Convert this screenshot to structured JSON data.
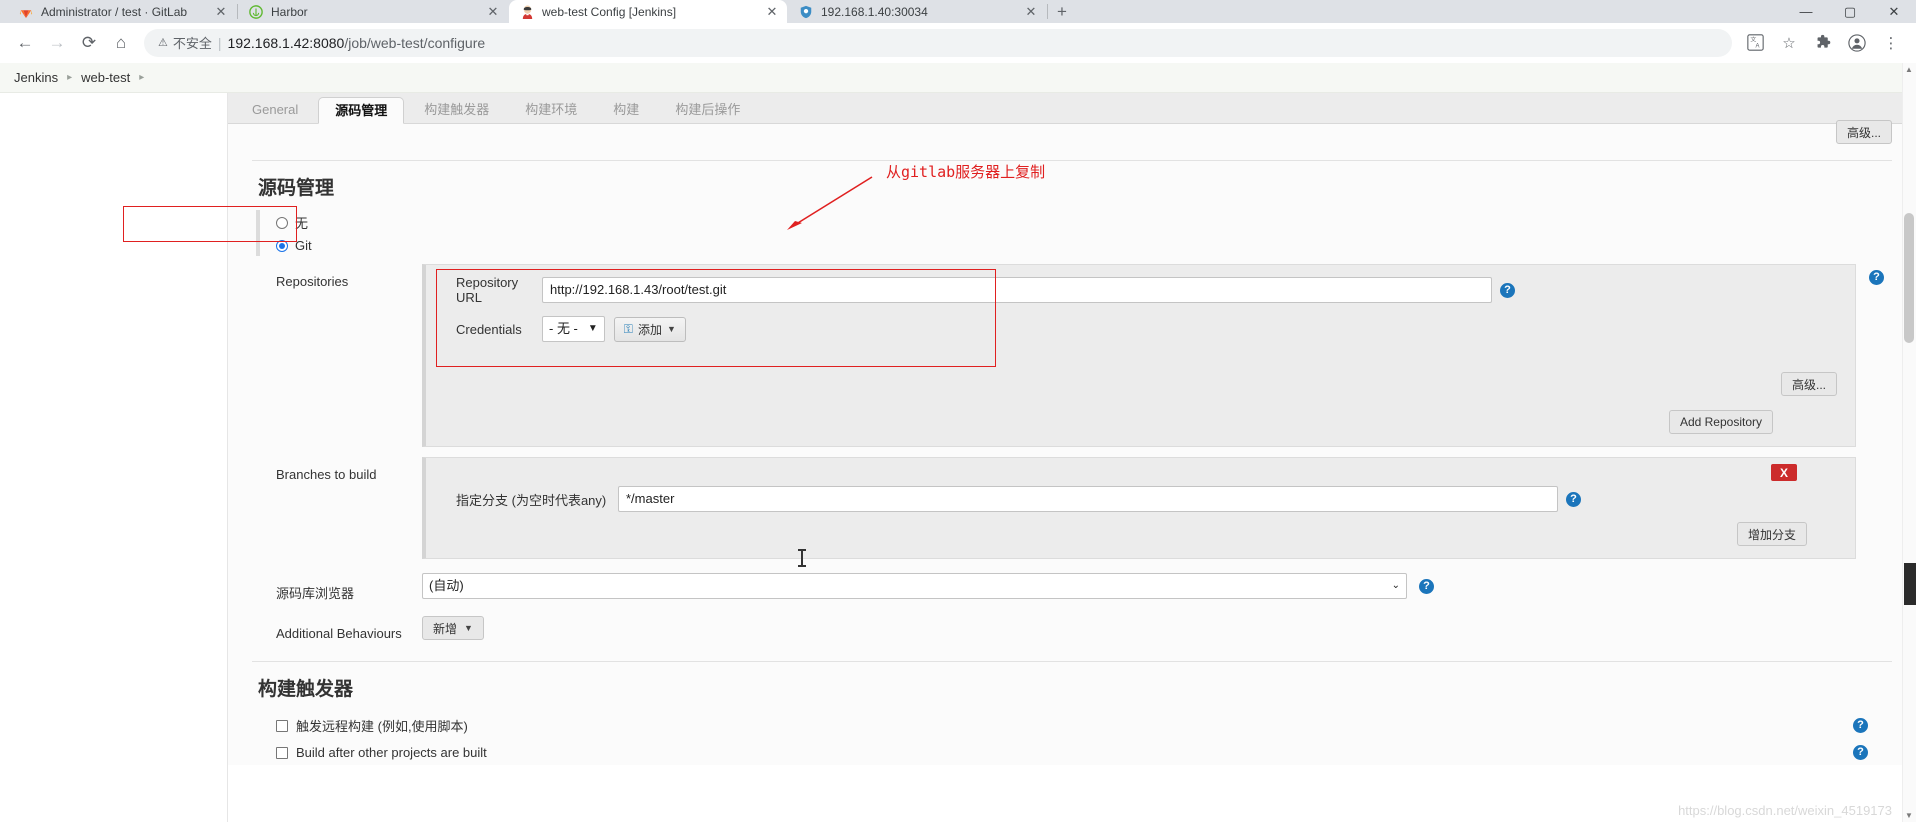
{
  "browser": {
    "tabs": [
      {
        "title": "Administrator / test · GitLab",
        "favicon": "gitlab-icon",
        "glyph": "🦊",
        "active": false
      },
      {
        "title": "Harbor",
        "favicon": "harbor-icon",
        "glyph": "🛡",
        "active": false
      },
      {
        "title": "web-test Config [Jenkins]",
        "favicon": "jenkins-icon",
        "glyph": "👤",
        "active": true
      },
      {
        "title": "192.168.1.40:30034",
        "favicon": "shield-icon",
        "glyph": "🛡",
        "active": false
      }
    ],
    "new_tab_label": "+",
    "window_controls": [
      "—",
      "▢",
      "✕"
    ],
    "nav": {
      "back": "←",
      "forward": "→",
      "reload": "⟳",
      "home": "⌂"
    },
    "omnibox": {
      "warning_icon": "not-secure-icon",
      "warning_text": "不安全",
      "url_host": "192.168.1.42:8080",
      "url_path": "/job/web-test/configure"
    },
    "toolbar_icons": [
      "translate-icon",
      "bookmark-star-icon",
      "extensions-icon",
      "profile-icon",
      "menu-icon"
    ]
  },
  "breadcrumbs": {
    "items": [
      "Jenkins",
      "web-test"
    ],
    "separator": "▸"
  },
  "config_tabs": [
    {
      "label": "General",
      "active": false
    },
    {
      "label": "源码管理",
      "active": true
    },
    {
      "label": "构建触发器",
      "active": false
    },
    {
      "label": "构建环境",
      "active": false
    },
    {
      "label": "构建",
      "active": false
    },
    {
      "label": "构建后操作",
      "active": false
    }
  ],
  "top_advanced_button": "高级...",
  "scm": {
    "title": "源码管理",
    "options": [
      {
        "label": "无",
        "checked": false
      },
      {
        "label": "Git",
        "checked": true
      }
    ],
    "repositories": {
      "label": "Repositories",
      "repository_url": {
        "label": "Repository URL",
        "value": "http://192.168.1.43/root/test.git"
      },
      "credentials": {
        "label": "Credentials",
        "value": "- 无 -",
        "add_button": "添加"
      },
      "advanced_button": "高级...",
      "add_repository_button": "Add Repository"
    },
    "branches": {
      "label": "Branches to build",
      "delete_button": "X",
      "specifier_label": "指定分支 (为空时代表any)",
      "specifier_value": "*/master",
      "add_branch_button": "增加分支"
    },
    "repo_browser": {
      "label": "源码库浏览器",
      "value": "(自动)"
    },
    "additional_behaviours": {
      "label": "Additional Behaviours",
      "add_button": "新增"
    }
  },
  "triggers": {
    "title": "构建触发器",
    "items": [
      {
        "label": "触发远程构建 (例如,使用脚本)",
        "checked": false
      },
      {
        "label": "Build after other projects are built",
        "checked": false
      }
    ]
  },
  "annotation": {
    "text": "从gitlab服务器上复制",
    "color": "#e02020"
  },
  "watermark": "https://blog.csdn.net/weixin_4519173"
}
